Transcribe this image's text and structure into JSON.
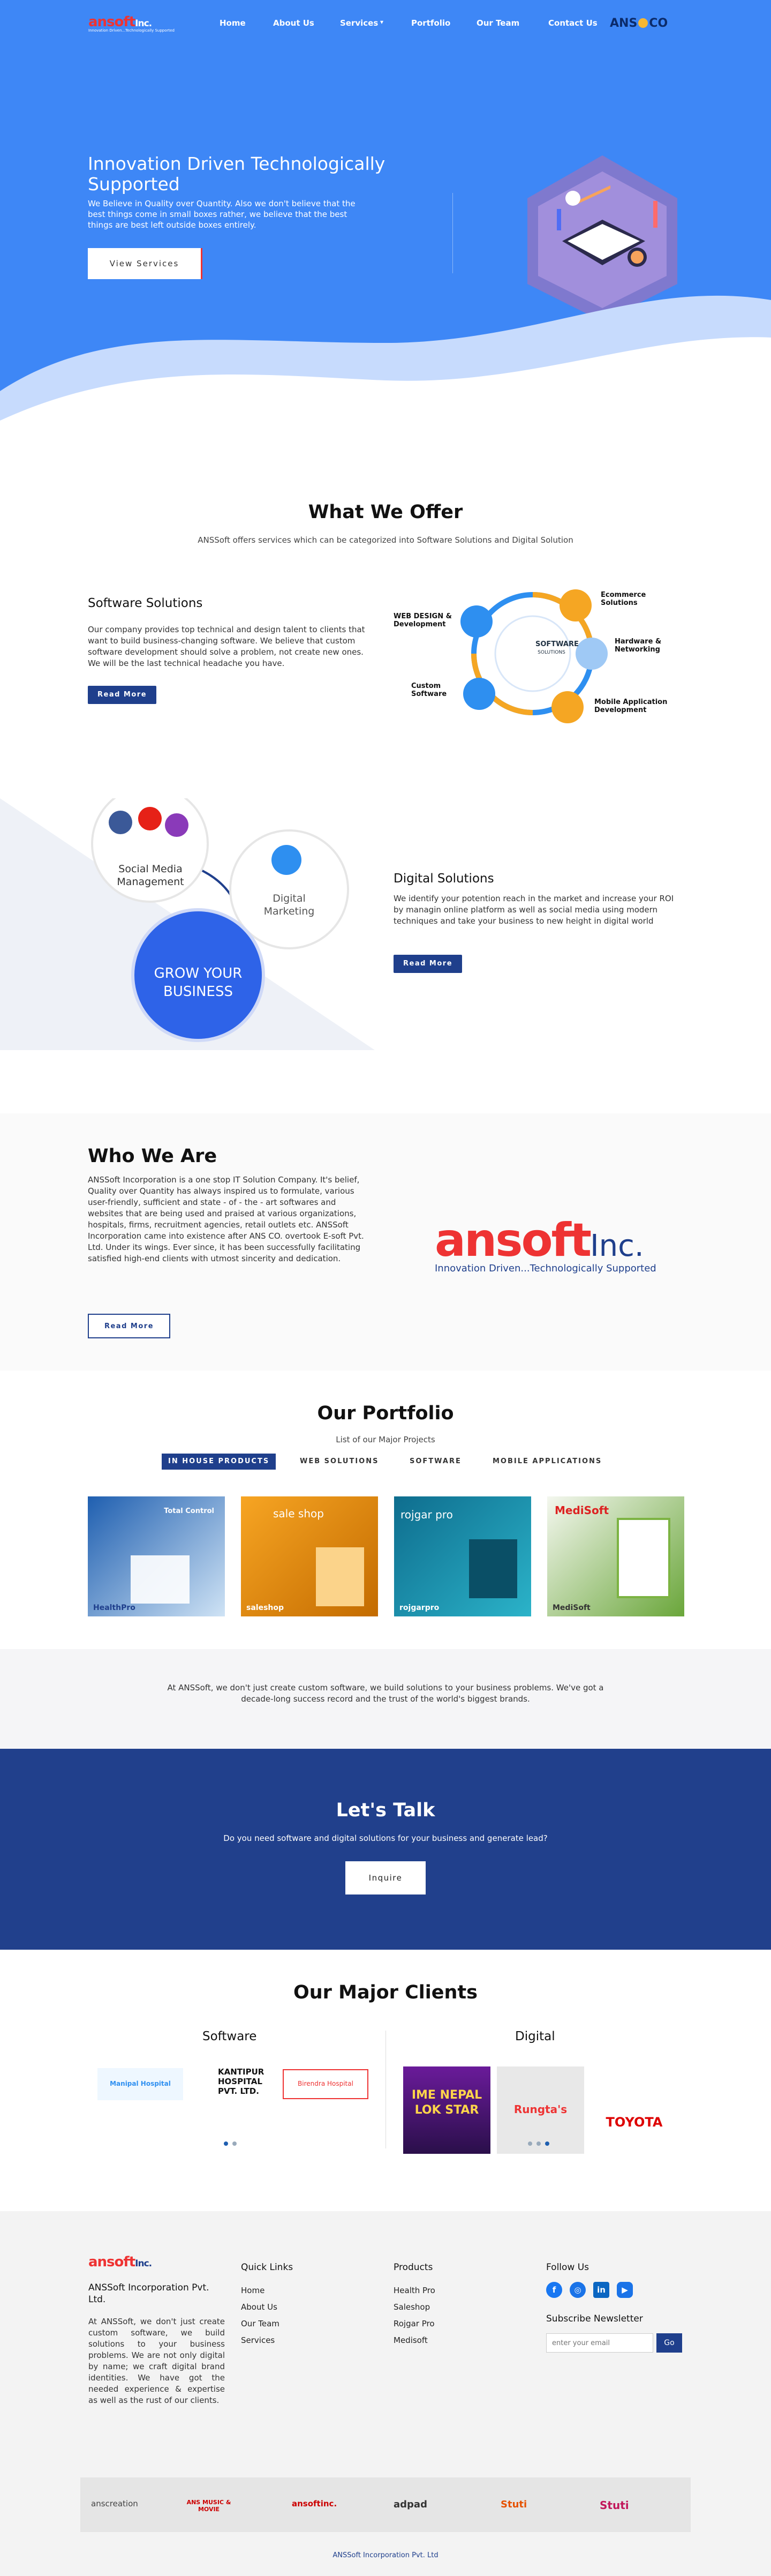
{
  "nav": {
    "logo_main": "ansoft",
    "logo_suffix": "Inc.",
    "logo_tagline": "Innovation Driven...Technologically Supported",
    "items": [
      "Home",
      "About Us",
      "Services",
      "Portfolio",
      "Our Team",
      "Contact Us"
    ],
    "services_caret": "▾",
    "ansco_left": "ANS",
    "ansco_right": "CO"
  },
  "hero": {
    "title": "Innovation Driven Technologically Supported",
    "text": "We Believe in Quality over Quantity. Also we don't believe that the best things come in small boxes rather, we believe that the best things are best left outside boxes entirely.",
    "button": "View Services"
  },
  "offer": {
    "title": "What We Offer",
    "subtitle": "ANSSoft offers services which can be categorized into Software Solutions and Digital Solution",
    "software": {
      "heading": "Software Solutions",
      "text": "Our company provides top technical and design talent to clients that want to build business-changing software. We believe that custom software development should solve a problem, not create new ones. We will be the last technical headache you have.",
      "button": "Read More",
      "diagram": {
        "center": "SOFTWARE",
        "center_sub": "SOLUTIONS",
        "web": "WEB DESIGN & Development",
        "ecommerce": "Ecommerce Solutions",
        "hardware": "Hardware & Networking",
        "mobile": "Mobile Application Development",
        "custom": "Custom Software"
      }
    },
    "digital": {
      "heading": "Digital Solutions",
      "text": "We identify your potention reach in the market and increase your ROI by managin online platform as well as social media using modern techniques and take your business to new height in digital world",
      "button": "Read More",
      "diagram": {
        "social": "Social Media Management",
        "marketing": "Digital Marketing",
        "grow": "GROW YOUR BUSINESS"
      }
    }
  },
  "who": {
    "title": "Who We Are",
    "text": "ANSSoft Incorporation is a one stop IT Solution Company. It's belief, Quality over Quantity has always inspired us to formulate, various user-friendly, sufficient and state - of - the - art softwares and websites that are being used and praised at various organizations, hospitals, firms, recruitment agencies, retail outlets etc. ANSSoft Incorporation came into existence after ANS CO. overtook E-soft Pvt. Ltd. Under its wings. Ever since, it has been successfully facilitating satisfied high-end clients with utmost sincerity and dedication.",
    "button": "Read More",
    "logo_main": "ansoft",
    "logo_suffix": "Inc.",
    "logo_tagline": "Innovation Driven...Technologically Supported"
  },
  "portfolio": {
    "title": "Our Portfolio",
    "subtitle": "List of our Major Projects",
    "tabs": [
      "IN HOUSE PRODUCTS",
      "WEB SOLUTIONS",
      "SOFTWARE",
      "MOBILE APPLICATIONS"
    ],
    "items": [
      {
        "label": "Total Control",
        "name": "HealthPro"
      },
      {
        "label": "sale shop",
        "name": "saleshop"
      },
      {
        "label": "rojgar pro",
        "name": "rojgarpro"
      },
      {
        "label": "MediSoft",
        "name": "MediSoft"
      }
    ]
  },
  "statement": "At ANSSoft, we don't just create custom software, we build solutions to your business problems. We've got a decade-long success record and the trust of the world's biggest brands.",
  "talk": {
    "title": "Let's Talk",
    "text": "Do you need software and digital solutions for your business and generate lead?",
    "button": "Inquire"
  },
  "clients": {
    "title": "Our Major Clients",
    "software_title": "Software",
    "digital_title": "Digital",
    "software": [
      "Manipal Hospital",
      "KANTIPUR HOSPITAL PVT. LTD.",
      "Birendra Hospital"
    ],
    "digital": [
      "IME NEPAL LOK STAR",
      "Rungta's",
      "TOYOTA"
    ]
  },
  "footer": {
    "logo_main": "ansoft",
    "logo_suffix": "Inc.",
    "company": "ANSSoft Incorporation Pvt. Ltd.",
    "about": "At ANSSoft, we don't just create custom software, we build solutions to your business problems. We are not only digital by name; we craft digital brand identities. We have got the needed experience & expertise as well as the rust of our clients.",
    "quick_title": "Quick Links",
    "quick": [
      "Home",
      "About Us",
      "Our Team",
      "Services"
    ],
    "products_title": "Products",
    "products": [
      "Health Pro",
      "Saleshop",
      "Rojgar Pro",
      "Medisoft"
    ],
    "follow_title": "Follow Us",
    "social": [
      "f",
      "◎",
      "in",
      "▶"
    ],
    "newsletter_title": "Subscribe Newsletter",
    "email_placeholder": "enter your email",
    "go": "Go",
    "partners": [
      "anscreation",
      "ANS MUSIC & MOVIE",
      "ansoftinc.",
      "adpad",
      "Stuti",
      "Stuti"
    ],
    "copyright": "ANSSoft Incorporation Pvt. Ltd"
  },
  "colors": {
    "primary": "#3e87f6",
    "navy": "#21408c",
    "accent": "#e33333"
  }
}
